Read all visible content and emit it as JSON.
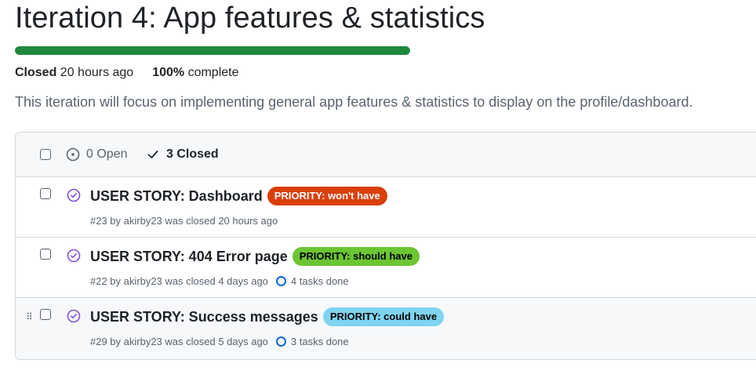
{
  "milestone": {
    "title": "Iteration 4: App features & statistics",
    "progress_percent": 100,
    "status_label": "Closed",
    "closed_time": "20 hours ago",
    "percent_label": "100%",
    "complete_label": "complete",
    "description": "This iteration will focus on implementing general app features & statistics to display on the profile/dashboard."
  },
  "filters": {
    "open_label": "0 Open",
    "closed_label": "3 Closed"
  },
  "issues": [
    {
      "title": "USER STORY: Dashboard",
      "label": "PRIORITY: won't have",
      "label_color": "#d93f0b",
      "meta": "#23 by akirby23 was closed 20 hours ago",
      "tasks": ""
    },
    {
      "title": "USER STORY: 404 Error page",
      "label": "PRIORITY: should have",
      "label_color": "#6cc533",
      "meta": "#22 by akirby23 was closed 4 days ago",
      "tasks": "4 tasks done"
    },
    {
      "title": "USER STORY: Success messages",
      "label": "PRIORITY: could have",
      "label_color": "#7fd4f1",
      "meta": "#29 by akirby23 was closed 5 days ago",
      "tasks": "3 tasks done"
    }
  ],
  "icons": {
    "open": "issue-open-icon",
    "closed_check": "check-icon",
    "issue_closed": "issue-closed-icon",
    "drag": "drag-handle-icon",
    "tasks": "task-progress-icon"
  },
  "colors": {
    "progress": "#1f883d",
    "closed_icon": "#8250df",
    "tasks_ring": "#0969da"
  }
}
